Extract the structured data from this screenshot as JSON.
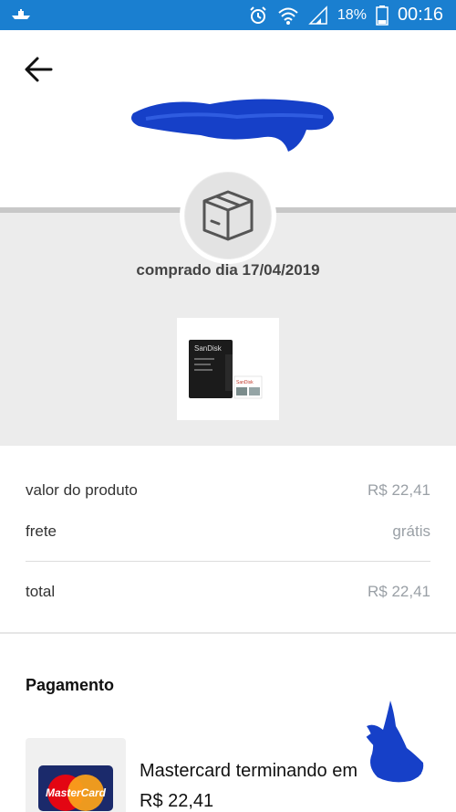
{
  "status_bar": {
    "battery_percent": "18%",
    "time": "00:16",
    "icons": [
      "boat-icon",
      "alarm-icon",
      "wifi-icon",
      "signal-icon",
      "battery-icon"
    ]
  },
  "header": {
    "back_icon": "arrow-left-icon"
  },
  "order": {
    "purchase_date": "comprado dia 17/04/2019",
    "product_icon": "package-box-icon",
    "product_thumbnail": "sandisk-microsd-card"
  },
  "summary": {
    "product_label": "valor do produto",
    "product_value": "R$ 22,41",
    "shipping_label": "frete",
    "shipping_value": "grátis",
    "total_label": "total",
    "total_value": "R$ 22,41"
  },
  "payment": {
    "title": "Pagamento",
    "card_brand": "MasterCard",
    "card_text": "Mastercard terminando em",
    "amount": "R$ 22,41"
  },
  "colors": {
    "status_bar": "#1a7fd0",
    "band": "#ececec",
    "muted_value": "#9aa0a6",
    "scribble": "#1640c8"
  }
}
